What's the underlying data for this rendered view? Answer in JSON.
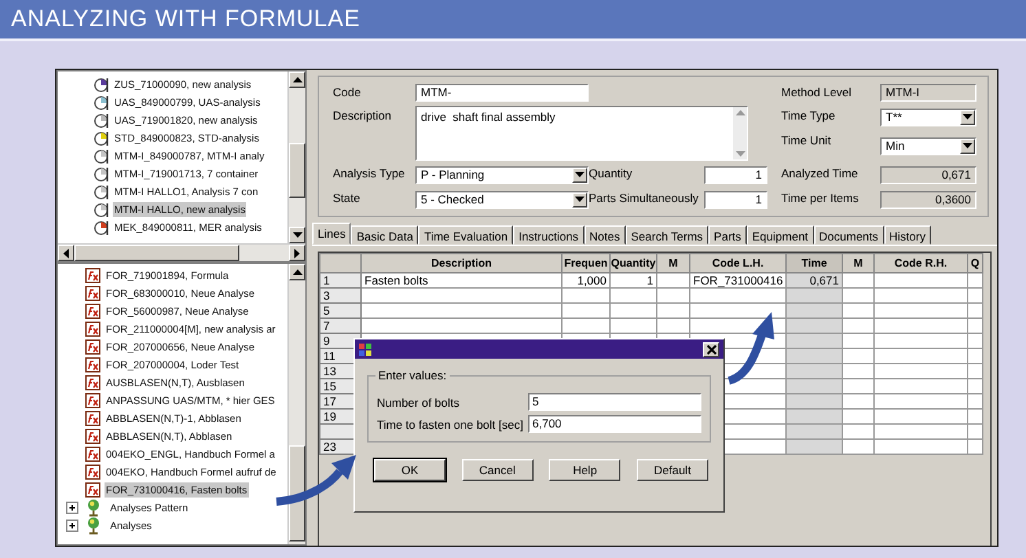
{
  "header": {
    "title": "ANALYZING WITH FORMULAE"
  },
  "analysis_tree": {
    "items": [
      {
        "label": "ZUS_71000090, new analysis",
        "color": "#5a3c9c",
        "selected": false
      },
      {
        "label": "UAS_849000799, UAS-analysis",
        "color": "#8cc0d0",
        "selected": false
      },
      {
        "label": "UAS_719001820, new analysis",
        "color": "#b8b8b8",
        "selected": false
      },
      {
        "label": "STD_849000823, STD-analysis",
        "color": "#e0d010",
        "selected": false
      },
      {
        "label": "MTM-I_849000787, MTM-I analy",
        "color": "#c4c4c4",
        "selected": false
      },
      {
        "label": "MTM-I_719001713, 7 container",
        "color": "#c4c4c4",
        "selected": false
      },
      {
        "label": "MTM-I HALLO1, Analysis 7 con",
        "color": "#c4c4c4",
        "selected": false
      },
      {
        "label": "MTM-I HALLO, new analysis",
        "color": "#c4c4c4",
        "selected": true
      },
      {
        "label": "MEK_849000811, MER analysis",
        "color": "#d04020",
        "selected": false
      }
    ]
  },
  "formula_tree": {
    "items": [
      {
        "label": "FOR_719001894, Formula",
        "selected": false
      },
      {
        "label": "FOR_683000010, Neue Analyse",
        "selected": false
      },
      {
        "label": "FOR_56000987, Neue Analyse",
        "selected": false
      },
      {
        "label": "FOR_211000004[M], new analysis ar",
        "selected": false
      },
      {
        "label": "FOR_207000656, Neue Analyse",
        "selected": false
      },
      {
        "label": "FOR_207000004, Loder Test",
        "selected": false
      },
      {
        "label": "AUSBLASEN(N,T), Ausblasen",
        "selected": false
      },
      {
        "label": "ANPASSUNG UAS/MTM, * hier GES",
        "selected": false
      },
      {
        "label": "ABBLASEN(N,T)-1, Abblasen",
        "selected": false
      },
      {
        "label": "ABBLASEN(N,T), Abblasen",
        "selected": false
      },
      {
        "label": "004EKO_ENGL, Handbuch Formel a",
        "selected": false
      },
      {
        "label": "004EKO, Handbuch Formel aufruf de",
        "selected": false
      },
      {
        "label": "FOR_731000416, Fasten bolts",
        "selected": true
      }
    ],
    "roots": [
      {
        "label": "Analyses Pattern",
        "expanded": false
      },
      {
        "label": "Analyses",
        "expanded": false
      }
    ]
  },
  "form": {
    "code": {
      "label": "Code",
      "value": "MTM-"
    },
    "description": {
      "label": "Description",
      "value": "drive  shaft final assembly"
    },
    "analysis_type": {
      "label": "Analysis Type",
      "value": "P - Planning"
    },
    "state": {
      "label": "State",
      "value": "5 - Checked"
    },
    "quantity": {
      "label": "Quantity",
      "value": "1"
    },
    "parts_simultaneously": {
      "label": "Parts Simultaneously",
      "value": "1"
    },
    "method_level": {
      "label": "Method Level",
      "value": "MTM-I"
    },
    "time_type": {
      "label": "Time Type",
      "value": "T**"
    },
    "time_unit": {
      "label": "Time Unit",
      "value": "Min"
    },
    "analyzed_time": {
      "label": "Analyzed Time",
      "value": "0,671"
    },
    "time_per_items": {
      "label": "Time per Items",
      "value": "0,3600"
    }
  },
  "tabs": [
    {
      "label": "Lines",
      "selected": true
    },
    {
      "label": "Basic Data",
      "selected": false
    },
    {
      "label": "Time Evaluation",
      "selected": false
    },
    {
      "label": "Instructions",
      "selected": false
    },
    {
      "label": "Notes",
      "selected": false
    },
    {
      "label": "Search Terms",
      "selected": false
    },
    {
      "label": "Parts",
      "selected": false
    },
    {
      "label": "Equipment",
      "selected": false
    },
    {
      "label": "Documents",
      "selected": false
    },
    {
      "label": "History",
      "selected": false
    }
  ],
  "table": {
    "columns": [
      {
        "label": "Description",
        "shaded": false
      },
      {
        "label": "Frequen",
        "shaded": false
      },
      {
        "label": "Quantity",
        "shaded": false
      },
      {
        "label": "M",
        "shaded": false
      },
      {
        "label": "Code L.H.",
        "shaded": false
      },
      {
        "label": "Time",
        "shaded": true
      },
      {
        "label": "M",
        "shaded": false
      },
      {
        "label": "Code R.H.",
        "shaded": false
      },
      {
        "label": "Q",
        "shaded": false
      }
    ],
    "rows": [
      {
        "label": "1",
        "cells": [
          "Fasten bolts",
          "1,000",
          "1",
          null,
          "FOR_731000416",
          "0,671",
          null,
          null,
          null
        ]
      },
      {
        "label": "3"
      },
      {
        "label": "5"
      },
      {
        "label": "7"
      },
      {
        "label": "9"
      },
      {
        "label": "11"
      },
      {
        "label": "13"
      },
      {
        "label": "15"
      },
      {
        "label": "17"
      },
      {
        "label": "19"
      },
      {},
      {
        "label": "23"
      }
    ]
  },
  "dialog": {
    "group": "Enter values:",
    "fields": [
      {
        "label": "Number of bolts",
        "value": "5"
      },
      {
        "label": "Time to fasten one bolt [sec]",
        "value": "6,700"
      }
    ],
    "buttons": [
      {
        "label": "OK",
        "default": true
      },
      {
        "label": "Cancel",
        "default": false
      },
      {
        "label": "Help",
        "default": false
      },
      {
        "label": "Default",
        "default": false
      }
    ]
  }
}
